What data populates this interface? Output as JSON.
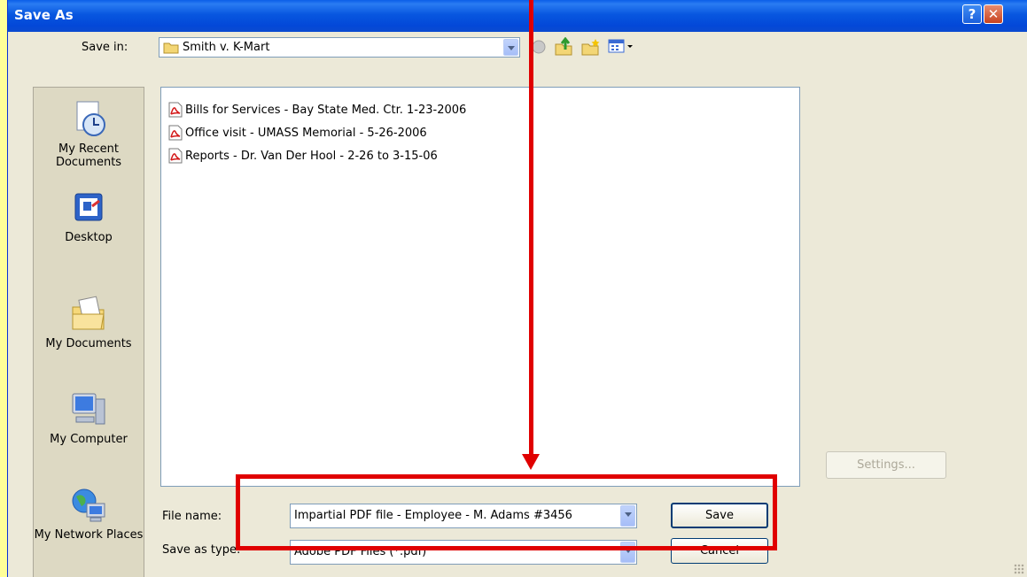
{
  "window": {
    "title": "Save As"
  },
  "toolbar": {
    "save_in_label": "Save in:",
    "save_in_value": "Smith v. K-Mart"
  },
  "places": [
    {
      "label": "My Recent Documents",
      "icon": "recent-documents-icon"
    },
    {
      "label": "Desktop",
      "icon": "desktop-icon"
    },
    {
      "label": "My Documents",
      "icon": "my-documents-icon"
    },
    {
      "label": "My Computer",
      "icon": "my-computer-icon"
    },
    {
      "label": "My Network Places",
      "icon": "network-places-icon"
    }
  ],
  "files": [
    "Bills for Services - Bay State Med. Ctr. 1-23-2006",
    "Office visit - UMASS Memorial - 5-26-2006",
    "Reports - Dr. Van Der Hool - 2-26 to 3-15-06"
  ],
  "form": {
    "file_name_label": "File name:",
    "file_name_value": "Impartial PDF file - Employee - M. Adams #3456",
    "save_type_label": "Save as type:",
    "save_type_value": "Adobe PDF Files (*.pdf)"
  },
  "buttons": {
    "settings": "Settings...",
    "save": "Save",
    "cancel": "Cancel"
  },
  "colors": {
    "annotation": "#e00000",
    "page_background": "#ffff99",
    "titlebar": "#0a5ee8"
  }
}
